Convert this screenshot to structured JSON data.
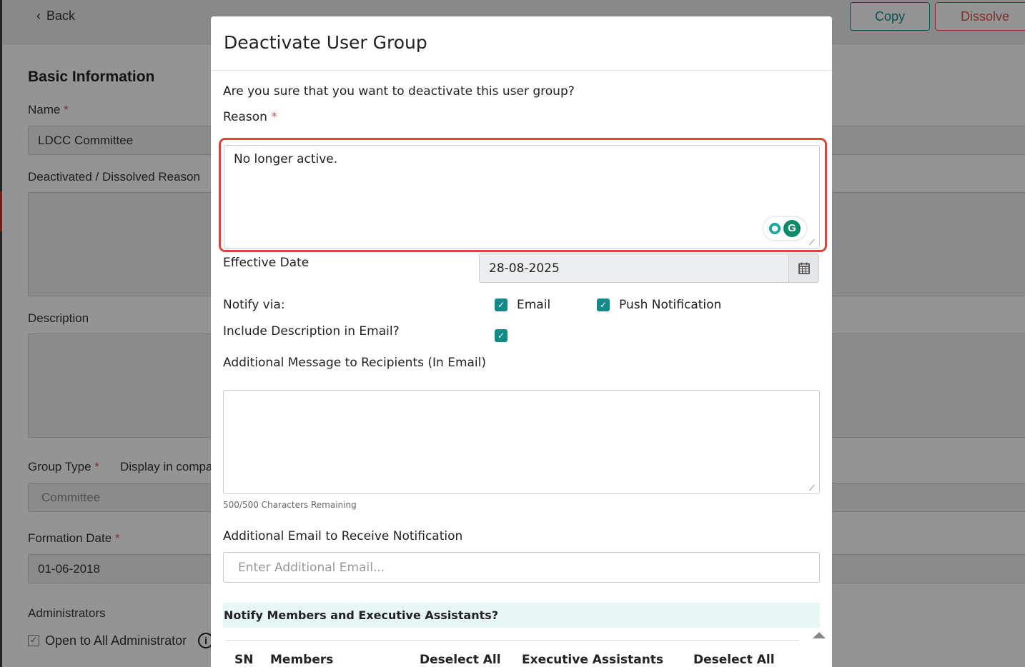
{
  "background": {
    "back_label": "Back",
    "copy_label": "Copy",
    "dissolve_label": "Dissolve",
    "section_title": "Basic Information",
    "name_label": "Name",
    "name_value": "LDCC Committee",
    "deactivated_reason_label": "Deactivated / Dissolved Reason",
    "description_label": "Description",
    "group_type_label": "Group Type",
    "display_in_label": "Display in compa",
    "group_type_value": "Committee",
    "formation_date_label": "Formation Date",
    "formation_date_value": "01-06-2018",
    "administrators_label": "Administrators",
    "open_to_all_label": "Open to All Administrator",
    "required_mark": "*",
    "checkbox_mark": "✓",
    "info_mark": "i"
  },
  "modal": {
    "title": "Deactivate User Group",
    "question": "Are you sure that you want to deactivate this user group?",
    "reason_label": "Reason",
    "required_mark": "*",
    "reason_value": "No longer active.",
    "effective_date_label": "Effective Date",
    "effective_date_value": "28-08-2025",
    "notify_via_label": "Notify via:",
    "email_label": "Email",
    "push_label": "Push Notification",
    "include_description_label": "Include Description in Email?",
    "additional_message_label": "Additional Message to Recipients (In Email)",
    "char_count": "500/500 Characters Remaining",
    "additional_email_label": "Additional Email to Receive Notification",
    "additional_email_placeholder": "Enter Additional Email...",
    "notify_members_label": "Notify Members and Executive Assistants?",
    "table_headers": {
      "sn": "SN",
      "members": "Members",
      "deselect_all_members": "Deselect All",
      "executive_assistants": "Executive Assistants",
      "deselect_all_ea": "Deselect All"
    },
    "check_mark": "✓",
    "grammarly_mark": "G",
    "grip_mark": "⟋"
  },
  "colors": {
    "accent": "#138a8a",
    "danger": "#d9534f",
    "highlight": "#d9473b",
    "banner": "#e6f7f5"
  },
  "icons": [
    "chevron-left-icon",
    "calendar-icon",
    "grammarly-icon",
    "bulb-icon",
    "info-icon",
    "resize-grip-icon",
    "scroll-up-icon"
  ]
}
